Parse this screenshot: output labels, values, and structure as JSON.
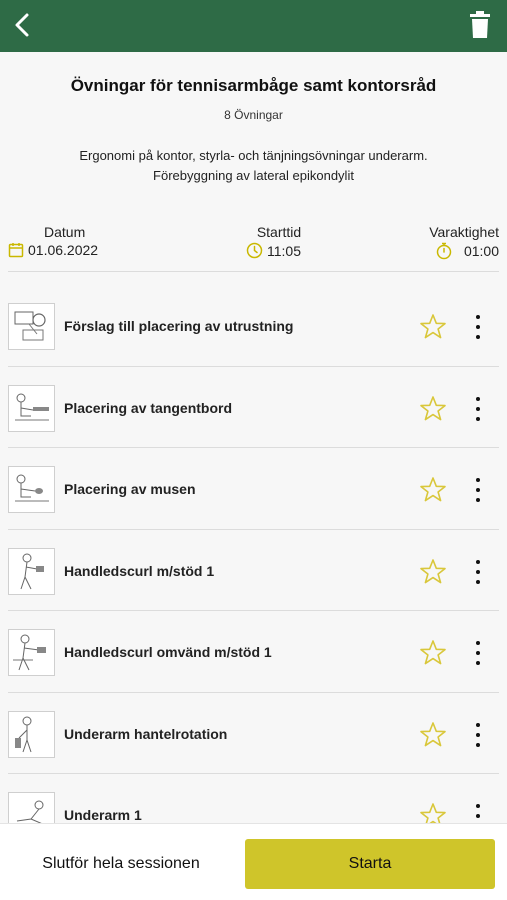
{
  "header": {
    "back_icon": "chevron-left-icon",
    "trash_icon": "trash-icon",
    "bar_color": "#2e6b46"
  },
  "session": {
    "title": "Övningar för tennisarmbåge samt kontorsråd",
    "count": "8 Övningar",
    "description_line1": "Ergonomi på kontor, styrla- och tänjningsövningar underarm.",
    "description_line2": "Förebyggning av lateral epikondylit"
  },
  "meta": {
    "date_label": "Datum",
    "date_value": "01.06.2022",
    "start_label": "Starttid",
    "start_value": "11:05",
    "duration_label": "Varaktighet",
    "duration_value": "01:00",
    "icon_color": "#c9b800"
  },
  "exercises": [
    {
      "label": "Förslag till placering av utrustning",
      "favorite": false
    },
    {
      "label": "Placering av tangentbord",
      "favorite": false
    },
    {
      "label": "Placering av musen",
      "favorite": false
    },
    {
      "label": "Handledscurl m/stöd 1",
      "favorite": false
    },
    {
      "label": "Handledscurl omvänd m/stöd 1",
      "favorite": false
    },
    {
      "label": "Underarm hantelrotation",
      "favorite": false
    },
    {
      "label": "Underarm 1",
      "favorite": false
    }
  ],
  "footer": {
    "finish_label": "Slutför hela sessionen",
    "start_label": "Starta",
    "accent": "#cfc52a"
  }
}
